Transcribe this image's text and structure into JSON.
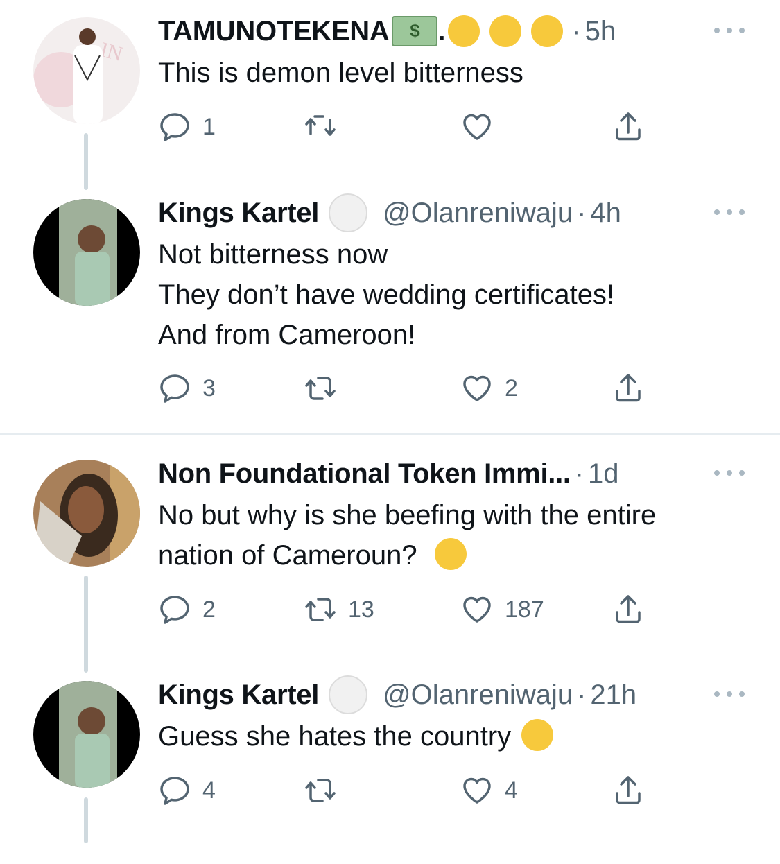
{
  "tweets": [
    {
      "name": "TAMUNOTEKENA",
      "name_suffix": ".",
      "money_glyph": "$",
      "handle": "",
      "time": "5h",
      "text_lines": [
        "This is demon level bitterness"
      ],
      "replies": "1",
      "retweets": "",
      "likes": ""
    },
    {
      "name": "Kings Kartel",
      "handle": "@Olanreniwaju",
      "time": "4h",
      "text_lines": [
        "Not bitterness now",
        "They don’t have wedding certificates!",
        "And from Cameroon!"
      ],
      "replies": "3",
      "retweets": "",
      "likes": "2"
    },
    {
      "name": "Non Foundational Token Immi...",
      "handle": "",
      "time": "1d",
      "text_lines": [
        "No but why is she beefing with the entire",
        "nation of Cameroun?"
      ],
      "replies": "2",
      "retweets": "13",
      "likes": "187"
    },
    {
      "name": "Kings Kartel",
      "handle": "@Olanreniwaju",
      "time": "21h",
      "text_lines": [
        "Guess she hates the country"
      ],
      "replies": "4",
      "retweets": "",
      "likes": "4"
    }
  ],
  "separator_dot": "·",
  "colors": {
    "text": "#0f1419",
    "secondary": "#536471",
    "thread_line": "#cfd9de",
    "divider": "#e6ecf0"
  }
}
